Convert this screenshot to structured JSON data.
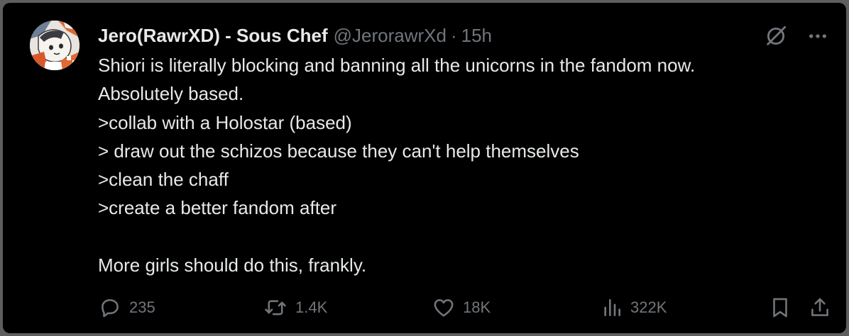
{
  "tweet": {
    "author": {
      "display_name": "Jero(RawrXD) - Sous Chef",
      "handle": "@JerorawrXd",
      "avatar_icon": "avatar-illustration"
    },
    "separator": "·",
    "time": "15h",
    "header_icons": [
      "grok-icon",
      "more-icon"
    ],
    "text": "Shiori is literally blocking and banning all the unicorns in the fandom now. \nAbsolutely based.\n>collab with a Holostar (based)\n> draw out the schizos because they can't help themselves\n>clean the chaff\n>create a better fandom after\n\nMore girls should do this, frankly.",
    "stats": {
      "replies": "235",
      "reposts": "1.4K",
      "likes": "18K",
      "views": "322K"
    },
    "action_icons": [
      "reply-icon",
      "repost-icon",
      "like-icon",
      "views-icon",
      "bookmark-icon",
      "share-icon"
    ],
    "colors": {
      "background": "#000000",
      "primary_text": "#e7e9ea",
      "secondary_text": "#71767b"
    }
  }
}
